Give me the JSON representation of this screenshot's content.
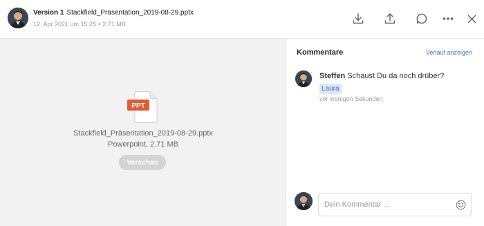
{
  "header": {
    "version_label": "Version 1",
    "file_name": "Stackfield_Präsentation_2019-08-29.pptx",
    "date": "12. Apr 2021 um 15:25",
    "separator": "•",
    "size": "2.71 MB"
  },
  "preview": {
    "badge": "PPT",
    "file_name": "Stackfield_Präsentation_2019-08-29.pptx",
    "file_type": "Powerpoint, 2.71 MB",
    "preview_button": "Vorschau"
  },
  "comments": {
    "title": "Kommentare",
    "history_link": "Verlauf anzeigen",
    "items": [
      {
        "author": "Steffen",
        "text": "Schaust Du da noch drüber?",
        "mention": "Laura",
        "time": "vor wenigen Sekunden"
      }
    ],
    "input_placeholder": "Dein Kommentar ..."
  },
  "icons": {
    "download": "download-icon",
    "share": "upload-icon",
    "comment": "comment-bubble-icon",
    "more": "more-dots-icon",
    "close": "close-icon",
    "emoji": "smiley-icon",
    "file": "ppt-file-icon"
  },
  "colors": {
    "link": "#3a7bd5",
    "ppt_badge": "#e35a33",
    "mention_bg": "#dbe7fb"
  }
}
